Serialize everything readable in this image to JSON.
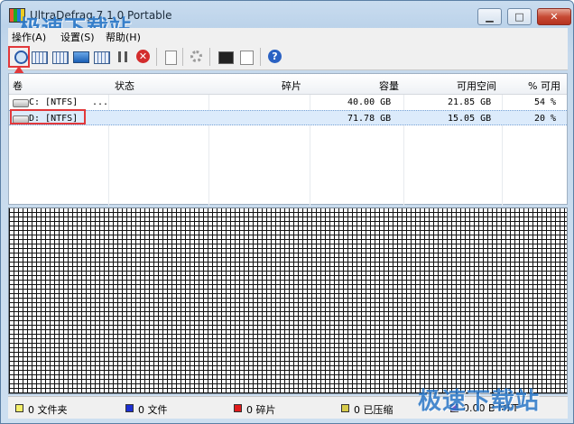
{
  "window": {
    "title": "UltraDefrag 7.1.0 Portable",
    "watermark": "极速下载站"
  },
  "menu": {
    "items": [
      "操作(A)",
      "设置(S)",
      "帮助(H)"
    ]
  },
  "toolbar": {
    "buttons": [
      "analyze-icon",
      "defrag-icon",
      "quick-opt-icon",
      "full-opt-icon",
      "mft-opt-icon",
      "pause-icon",
      "stop-icon",
      "report-icon",
      "settings-icon",
      "boot-time-icon",
      "boot-script-icon",
      "help-icon"
    ],
    "accent": "#e2383a"
  },
  "drive_list": {
    "columns": [
      "卷",
      "状态",
      "碎片",
      "容量",
      "可用空间",
      "% 可用"
    ],
    "rows": [
      {
        "volume": "C: [NTFS]",
        "status": "...",
        "fragments": "",
        "capacity": "40.00 GB",
        "free": "21.85 GB",
        "pct": "54 %"
      },
      {
        "volume": "D: [NTFS]",
        "status": "",
        "fragments": "",
        "capacity": "71.78 GB",
        "free": "15.05 GB",
        "pct": "20 %"
      }
    ]
  },
  "legend": [
    {
      "label": "0 文件夹",
      "color": "#f5f06a"
    },
    {
      "label": "0 文件",
      "color": "#1c2fd2"
    },
    {
      "label": "0 碎片",
      "color": "#e01b1b"
    },
    {
      "label": "0 已压缩",
      "color": "#d7cb4a"
    },
    {
      "label": "0.00 B MFT",
      "color": "#7a4fc1"
    }
  ]
}
